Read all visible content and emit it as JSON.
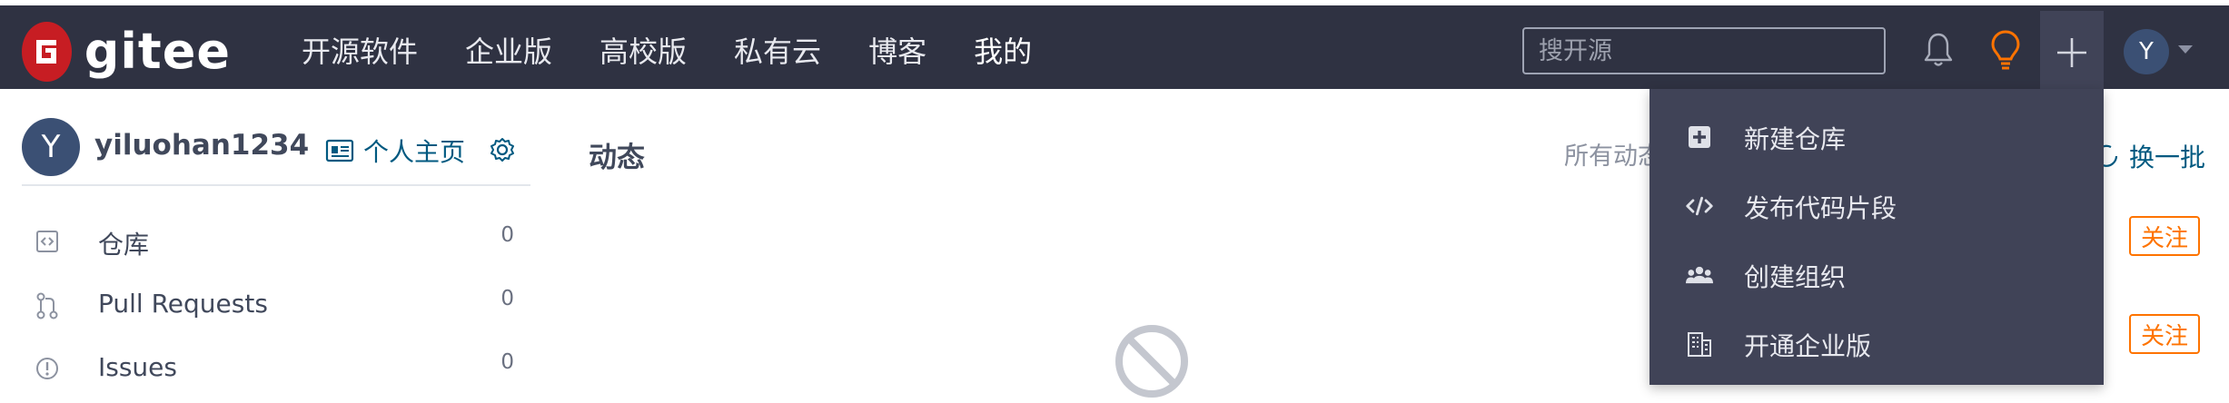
{
  "brand": {
    "name": "gitee",
    "logo_letter": "G",
    "color": "#c71d23"
  },
  "nav": {
    "items": [
      {
        "label": "开源软件"
      },
      {
        "label": "企业版"
      },
      {
        "label": "高校版"
      },
      {
        "label": "私有云"
      },
      {
        "label": "博客"
      },
      {
        "label": "我的"
      }
    ]
  },
  "search": {
    "placeholder": "搜开源",
    "value": ""
  },
  "toolbar": {
    "icons": [
      "bell-icon",
      "lightbulb-icon",
      "plus-icon"
    ],
    "user_initial": "Y"
  },
  "profile": {
    "initial": "Y",
    "username": "yiluohan1234",
    "homepage_label": "个人主页"
  },
  "sidebar": {
    "items": [
      {
        "label": "仓库",
        "count": "0",
        "icon": "repo-icon"
      },
      {
        "label": "Pull Requests",
        "count": "0",
        "icon": "pull-request-icon"
      },
      {
        "label": "Issues",
        "count": "0",
        "icon": "issue-icon"
      }
    ]
  },
  "feed": {
    "title": "动态",
    "filter_label": "所有动态"
  },
  "recommend": {
    "refresh_label": "换一批",
    "follow_label": "关注"
  },
  "create_menu": {
    "items": [
      {
        "label": "新建仓库",
        "icon": "plus-square-icon"
      },
      {
        "label": "发布代码片段",
        "icon": "code-icon"
      },
      {
        "label": "创建组织",
        "icon": "group-icon"
      },
      {
        "label": "开通企业版",
        "icon": "building-icon"
      }
    ]
  },
  "colors": {
    "topbar": "#2f3242",
    "dropdown": "#404357",
    "link": "#005980",
    "accent_orange": "#fe7300"
  }
}
